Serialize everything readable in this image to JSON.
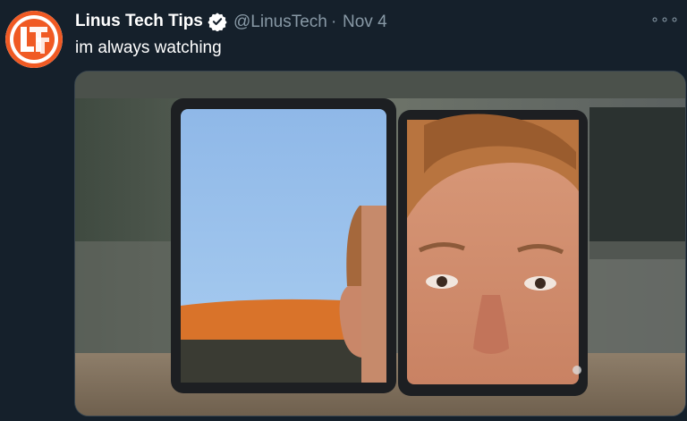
{
  "tweet": {
    "author_name": "Linus Tech Tips",
    "handle": "@LinusTech",
    "separator": "·",
    "date": "Nov 4",
    "text": "im always watching",
    "more_label": "∘∘∘"
  },
  "icons": {
    "avatar": "ltt-logo-avatar",
    "verified": "verified-badge-icon",
    "more": "more-options-icon"
  },
  "colors": {
    "background": "#15202b",
    "primary_text": "#ffffff",
    "secondary_text": "#8899a6",
    "logo_orange": "#f05a24"
  }
}
